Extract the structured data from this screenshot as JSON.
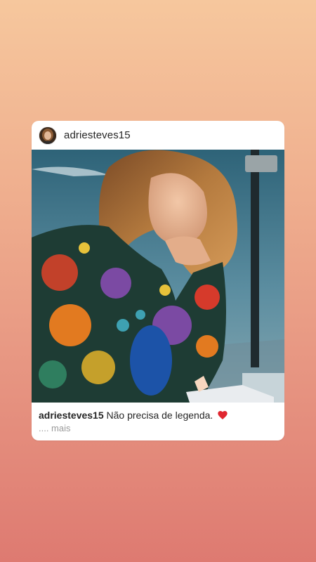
{
  "post": {
    "username": "adriesteves15",
    "caption_user": "adriesteves15",
    "caption_text": "Não precisa de legenda.",
    "more_label": ".... mais"
  },
  "colors": {
    "background_top": "#f6c79d",
    "background_bottom": "#de7a71",
    "card": "#ffffff",
    "heart": "#e0262f"
  },
  "icons": {
    "heart": "heart-icon"
  }
}
